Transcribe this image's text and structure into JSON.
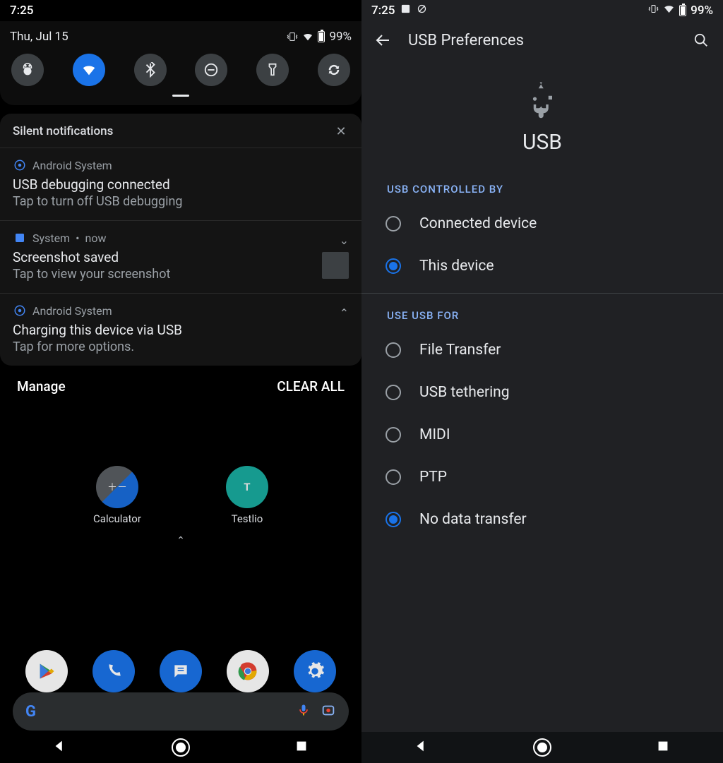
{
  "left": {
    "statusbar": {
      "time": "7:25",
      "battery": "99%"
    },
    "qs": {
      "date": "Thu, Jul 15",
      "battery": "99%"
    },
    "silent_header": "Silent notifications",
    "notifs": [
      {
        "app": "Android System",
        "title": "USB debugging connected",
        "sub": "Tap to turn off USB debugging"
      },
      {
        "app": "System",
        "time": "now",
        "title": "Screenshot saved",
        "sub": "Tap to view your screenshot"
      },
      {
        "app": "Android System",
        "title": "Charging this device via USB",
        "sub": "Tap for more options."
      }
    ],
    "actions": {
      "manage": "Manage",
      "clear": "CLEAR ALL"
    },
    "home_apps_row": [
      {
        "label": "Calculator"
      },
      {
        "label": "Testlio"
      }
    ]
  },
  "right": {
    "statusbar": {
      "time": "7:25",
      "battery": "99%"
    },
    "appbar_title": "USB Preferences",
    "hero_title": "USB",
    "section1": "USB CONTROLLED BY",
    "controlled_by": [
      {
        "label": "Connected device",
        "selected": false
      },
      {
        "label": "This device",
        "selected": true
      }
    ],
    "section2": "USE USB FOR",
    "use_for": [
      {
        "label": "File Transfer",
        "selected": false
      },
      {
        "label": "USB tethering",
        "selected": false
      },
      {
        "label": "MIDI",
        "selected": false
      },
      {
        "label": "PTP",
        "selected": false
      },
      {
        "label": "No data transfer",
        "selected": true
      }
    ]
  }
}
